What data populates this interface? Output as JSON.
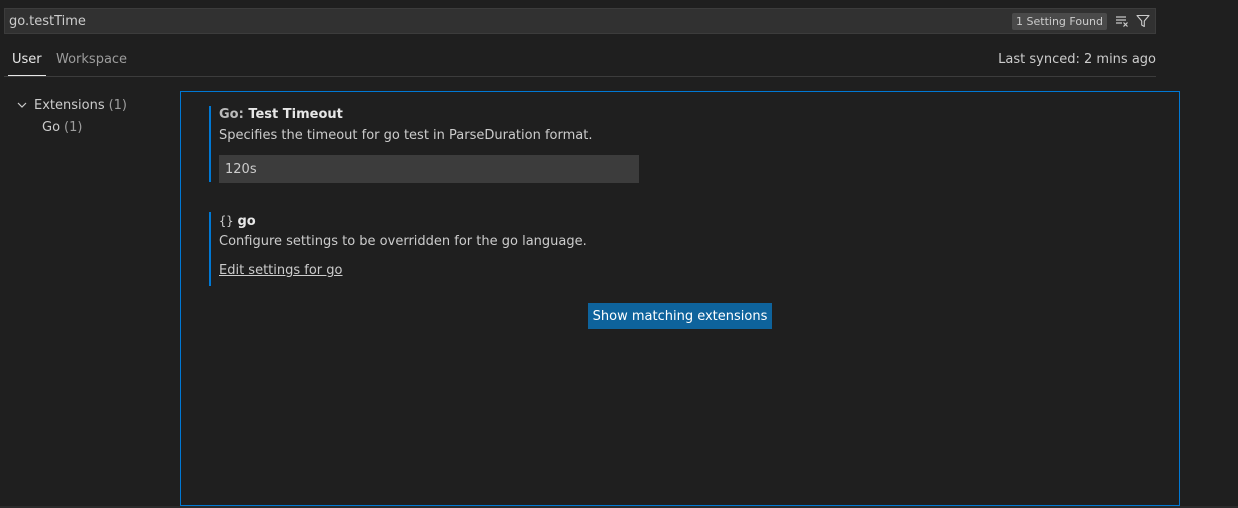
{
  "search": {
    "value": "go.testTime",
    "count_badge": "1 Setting Found",
    "clear_filter_icon": "clear-filter-icon",
    "filter_icon": "filter-icon"
  },
  "tabs": [
    {
      "label": "User",
      "active": true
    },
    {
      "label": "Workspace",
      "active": false
    }
  ],
  "sync_status": "Last synced: 2 mins ago",
  "toc": {
    "extensions": {
      "label": "Extensions",
      "count": "(1)"
    },
    "go": {
      "label": "Go",
      "count": "(1)"
    }
  },
  "settings": [
    {
      "category": "Go: ",
      "label": "Test Timeout",
      "description": "Specifies the timeout for go test in ParseDuration format.",
      "value": "120s"
    },
    {
      "icon": "{}",
      "label": "go",
      "description": "Configure settings to be overridden for the go language.",
      "link": "Edit settings for go"
    }
  ],
  "show_extensions_label": "Show matching extensions",
  "colors": {
    "accent": "#0078d4",
    "button": "#0e639c",
    "background": "#1f1f1f"
  }
}
